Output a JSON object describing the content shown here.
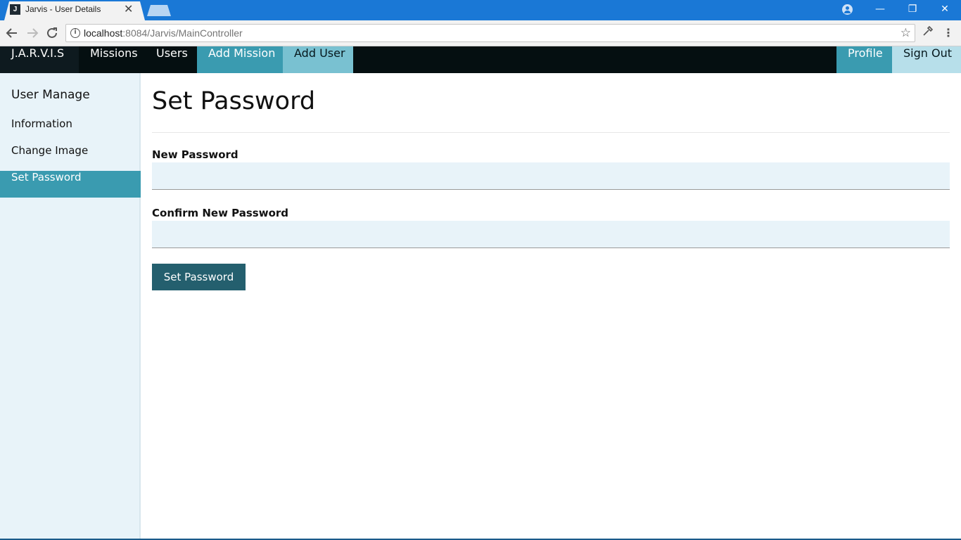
{
  "browser": {
    "tab_title": "Jarvis - User Details",
    "tab_close": "✕",
    "favicon_letter": "J",
    "url_host": "localhost",
    "url_path": ":8084/Jarvis/MainController",
    "window_controls": {
      "minimize": "—",
      "restore": "❐",
      "close": "✕"
    },
    "icons": {
      "back": "arrow-left-icon",
      "forward": "arrow-right-icon",
      "reload": "reload-icon",
      "info": "info-icon",
      "bookmark": "star-icon",
      "extension": "eyedropper-icon",
      "menu": "kebab-menu-icon",
      "account": "account-icon"
    },
    "accent_color": "#1a78d6"
  },
  "nav": {
    "brand": "J.A.R.V.I.S",
    "missions": "Missions",
    "users": "Users",
    "add_mission": "Add Mission",
    "add_user": "Add User",
    "profile": "Profile",
    "sign_out": "Sign Out"
  },
  "sidebar": {
    "heading": "User Manage",
    "items": [
      {
        "label": "Information",
        "active": false
      },
      {
        "label": "Change Image",
        "active": false
      },
      {
        "label": "Set Password",
        "active": true
      }
    ]
  },
  "main": {
    "title": "Set Password",
    "fields": [
      {
        "label": "New Password",
        "value": ""
      },
      {
        "label": "Confirm New Password",
        "value": ""
      }
    ],
    "submit_label": "Set Password"
  },
  "colors": {
    "nav_bg": "#050f11",
    "accent_teal": "#3a9bb0",
    "light_teal": "#79c1d1",
    "button_dark": "#245f6e",
    "input_bg": "#e8f3f9"
  }
}
